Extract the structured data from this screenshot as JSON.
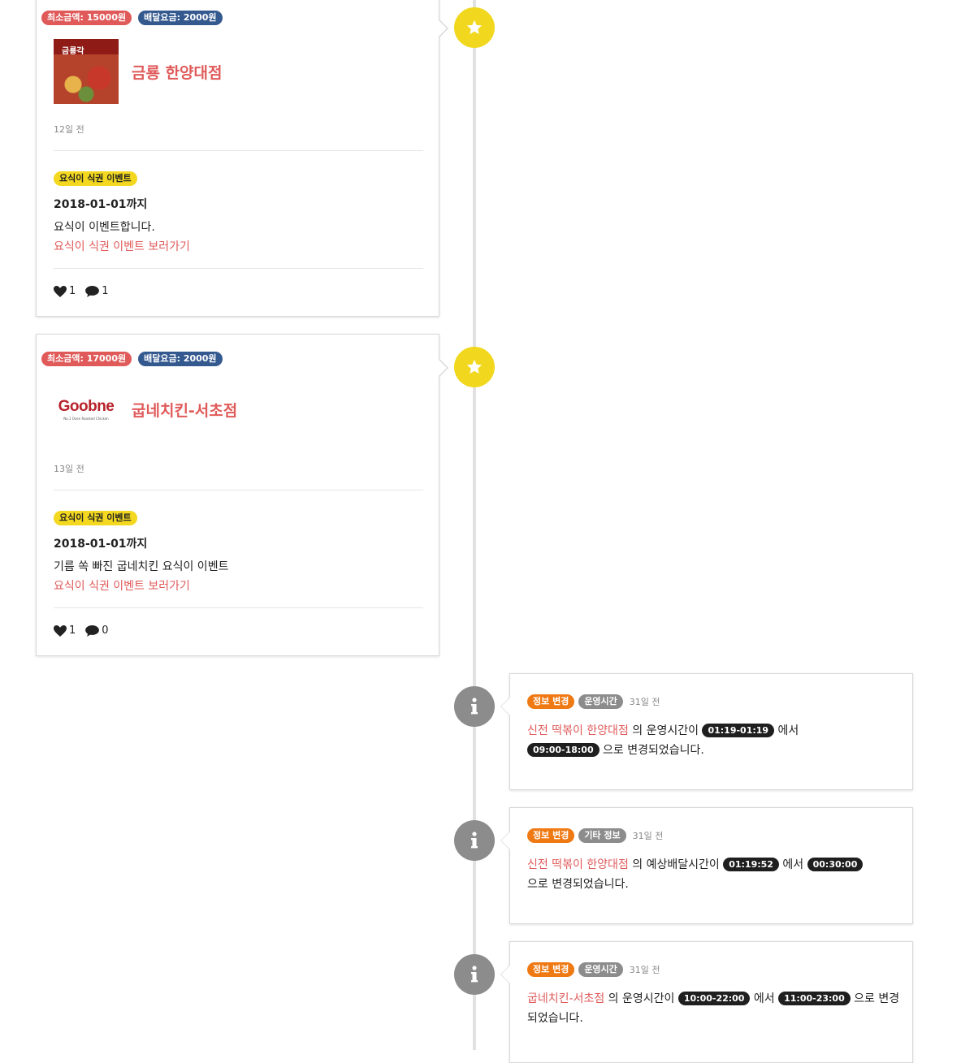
{
  "feed": {
    "event_cards": [
      {
        "min_order": "최소금액: 15000원",
        "delivery_fee": "배달요금: 2000원",
        "thumb_text": "금룡각",
        "store_name": "금룡 한양대점",
        "time_ago": "12일 전",
        "event_tag": "요식이 식권 이벤트",
        "deadline": "2018-01-01까지",
        "description": "요식이 이벤트합니다.",
        "link": "요식이 식권 이벤트 보러가기",
        "likes": "1",
        "comments": "1",
        "icon": "star-icon"
      },
      {
        "min_order": "최소금액: 17000원",
        "delivery_fee": "배달요금: 2000원",
        "logo_text": "Goobne",
        "logo_sub": "No.1 Oven Roasted Chicken",
        "store_name": "굽네치킨-서초점",
        "time_ago": "13일 전",
        "event_tag": "요식이 식권 이벤트",
        "deadline": "2018-01-01까지",
        "description": "기름 쏙 빠진 굽네치킨 요식이 이벤트",
        "link": "요식이 식권 이벤트 보러가기",
        "likes": "1",
        "comments": "0",
        "icon": "star-icon"
      }
    ],
    "info_cards": [
      {
        "tag_change": "정보 변경",
        "tag_type": "운영시간",
        "time_ago": "31일 전",
        "store_link": "신전 떡볶이 한양대점",
        "text_1": " 의 운영시간이 ",
        "from_value": "01:19-01:19",
        "text_2": "  에서 ",
        "to_value": "09:00-18:00",
        "text_3": "  으로 변경되었습니다.",
        "icon": "info-icon"
      },
      {
        "tag_change": "정보 변경",
        "tag_type": "기타 정보",
        "time_ago": "31일 전",
        "store_link": "신전 떡볶이 한양대점",
        "text_1": " 의 예상배달시간이 ",
        "from_value": "01:19:52",
        "text_2": "  에서 ",
        "to_value": "00:30:00",
        "text_3": " 으로 변경되었습니다.",
        "icon": "info-icon"
      },
      {
        "tag_change": "정보 변경",
        "tag_type": "운영시간",
        "time_ago": "31일 전",
        "store_link": "굽네치킨-서초점",
        "text_1": " 의 운영시간이 ",
        "from_value": "10:00-22:00",
        "text_2": "  에서 ",
        "to_value": "11:00-23:00",
        "text_3": "  으로 변경되었습니다.",
        "icon": "info-icon"
      }
    ]
  },
  "colors": {
    "accent_red": "#e05a5a",
    "fee_blue": "#34598f",
    "star_yellow": "#f1d81f",
    "info_grey": "#8c8c8c",
    "change_orange": "#ef7a14"
  }
}
